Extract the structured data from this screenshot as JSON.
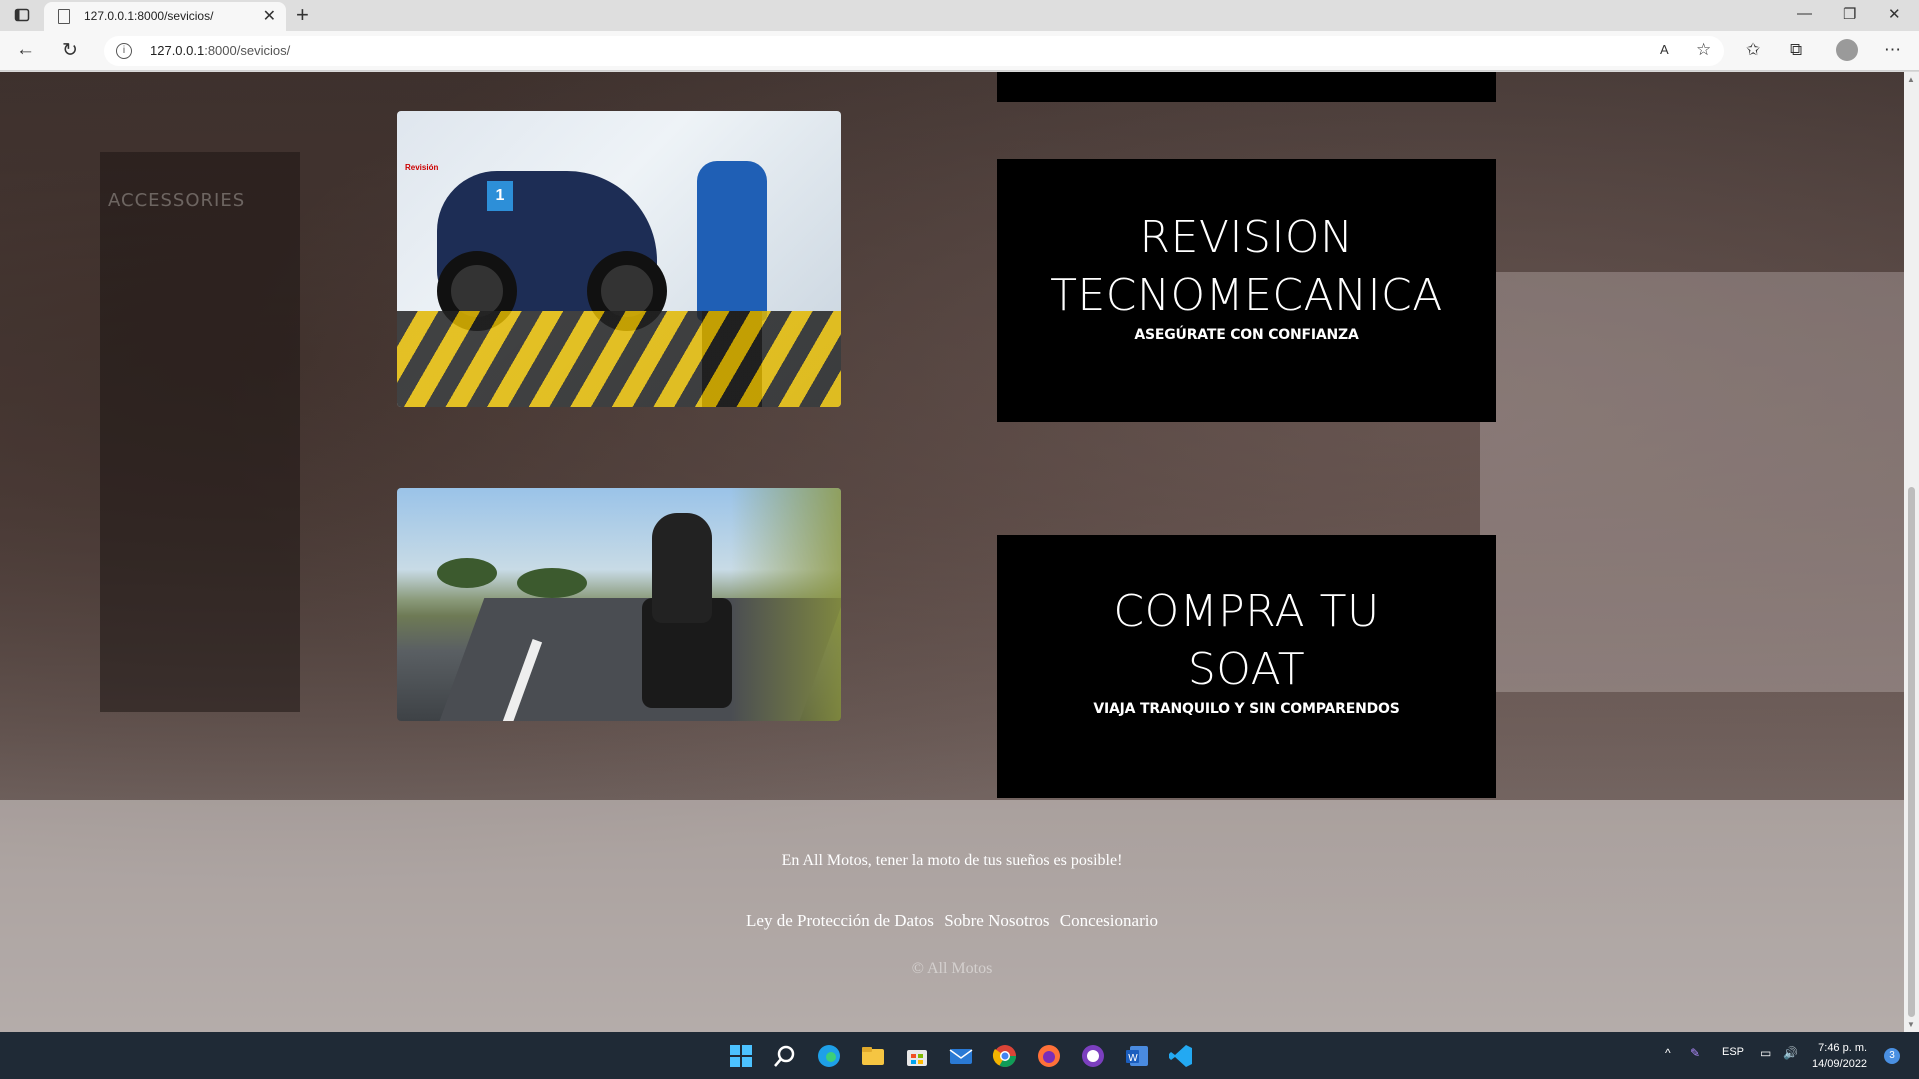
{
  "browser": {
    "tab_title": "127.0.0.1:8000/sevicios/",
    "tab_close": "✕",
    "new_tab": "+",
    "url_host": "127.0.0.1",
    "url_path": ":8000/sevicios/",
    "window": {
      "minimize": "—",
      "restore": "❐",
      "close": "✕"
    },
    "nav": {
      "back": "←",
      "reload": "↻",
      "info": "i"
    },
    "toolbar_icons": {
      "read_aloud": "A",
      "favorite": "☆",
      "favorites": "✩",
      "collections": "⧉",
      "menu": "⋯"
    }
  },
  "services": [
    {
      "title_line1": "REVISION",
      "title_line2": "TECNOMECANICA",
      "subtitle": "ASEGÚRATE CON CONFIANZA",
      "image_alt": "Revisión",
      "image_tag": "1"
    },
    {
      "title_line1": "COMPRA TU",
      "title_line2": "SOAT",
      "subtitle": "VIAJA TRANQUILO Y SIN COMPARENDOS"
    }
  ],
  "background": {
    "sign": "ACCESSORIES"
  },
  "footer": {
    "tagline": "En All Motos, tener la moto de tus sueños es posible!",
    "links": [
      "Ley de Protección de Datos",
      "Sobre Nosotros",
      "Concesionario"
    ],
    "copyright": "© All Motos"
  },
  "taskbar": {
    "apps": [
      "Start",
      "Search",
      "Edge",
      "File Explorer",
      "Microsoft Store",
      "Mail",
      "Chrome",
      "Firefox",
      "GitHub Desktop",
      "Word",
      "Visual Studio Code"
    ],
    "tray_chevron": "^",
    "language": "ESP",
    "time": "7:46 p. m.",
    "date": "14/09/2022",
    "notifications": "3"
  }
}
